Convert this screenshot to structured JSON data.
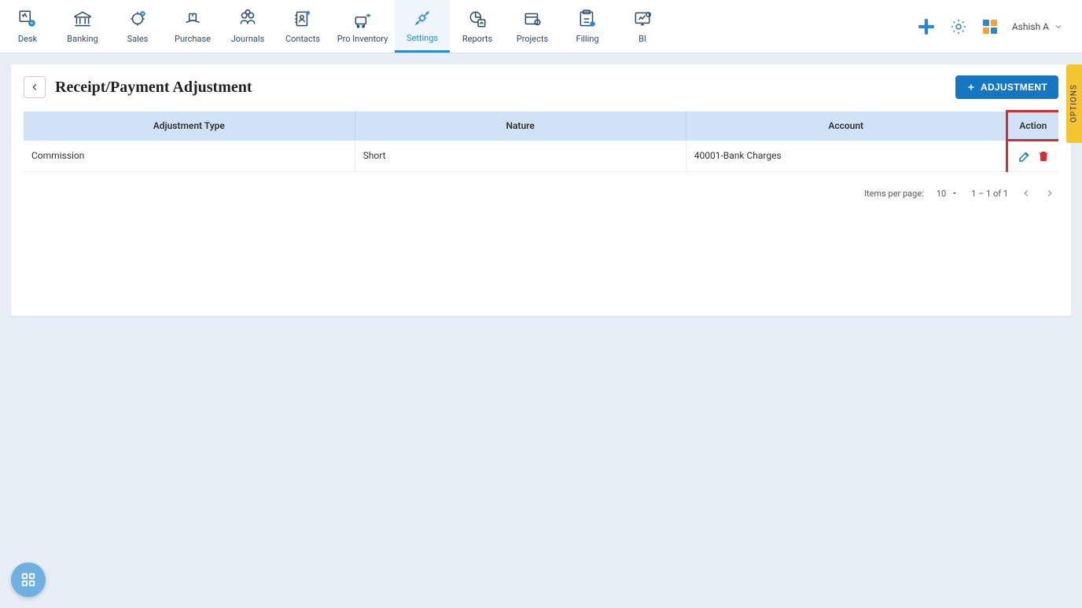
{
  "nav": [
    {
      "label": "Desk"
    },
    {
      "label": "Banking"
    },
    {
      "label": "Sales"
    },
    {
      "label": "Purchase"
    },
    {
      "label": "Journals"
    },
    {
      "label": "Contacts"
    },
    {
      "label": "Pro Inventory"
    },
    {
      "label": "Settings"
    },
    {
      "label": "Reports"
    },
    {
      "label": "Projects"
    },
    {
      "label": "Filling"
    },
    {
      "label": "BI"
    }
  ],
  "user": {
    "name": "Ashish A"
  },
  "page": {
    "title": "Receipt/Payment Adjustment"
  },
  "buttons": {
    "adjustment": "ADJUSTMENT"
  },
  "table": {
    "headers": {
      "type": "Adjustment Type",
      "nature": "Nature",
      "account": "Account",
      "action": "Action"
    },
    "rows": [
      {
        "type": "Commission",
        "nature": "Short",
        "account": "40001-Bank Charges"
      }
    ]
  },
  "paginator": {
    "items_per_page_label": "Items per page:",
    "items_per_page_value": "10",
    "range_label": "1 – 1 of 1"
  },
  "options_tab": "OPTIONS"
}
